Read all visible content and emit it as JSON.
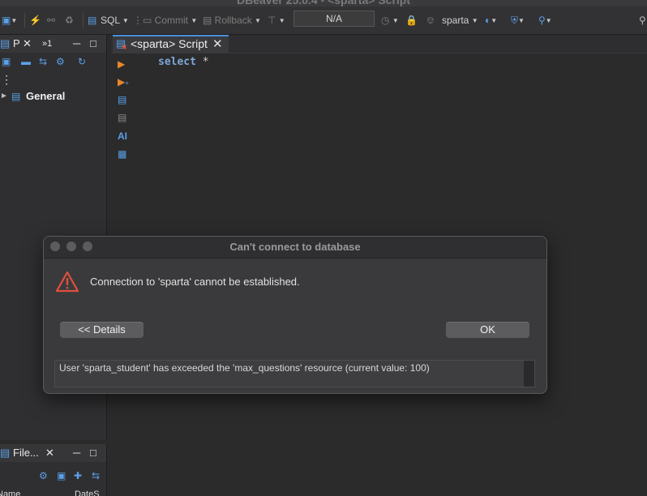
{
  "window": {
    "title": "DBeaver 25.0.4 - <sparta> Script"
  },
  "toolbar": {
    "sql_label": "SQL",
    "commit_label": "Commit",
    "rollback_label": "Rollback",
    "transaction_mode": "N/A",
    "connection_label": "sparta"
  },
  "left_panel": {
    "tab_projects": "P",
    "tab_other": "»1",
    "tree_item": "General"
  },
  "bottom_panel": {
    "tab_label": "File...",
    "col_name": "Name",
    "col_date": "DateS"
  },
  "editor": {
    "tab_label": "<sparta> Script",
    "code_keyword": "select",
    "code_rest": " *",
    "ai_label": "AI"
  },
  "dialog": {
    "title": "Can't connect to database",
    "message": "Connection to 'sparta' cannot be established.",
    "details_button": "<< Details",
    "ok_button": "OK",
    "details_text": "User 'sparta_student' has exceeded the 'max_questions' resource (current value: 100)"
  },
  "colors": {
    "accent": "#4a90d9",
    "warning": "#e0503c",
    "run_arrow": "#e8862a"
  }
}
